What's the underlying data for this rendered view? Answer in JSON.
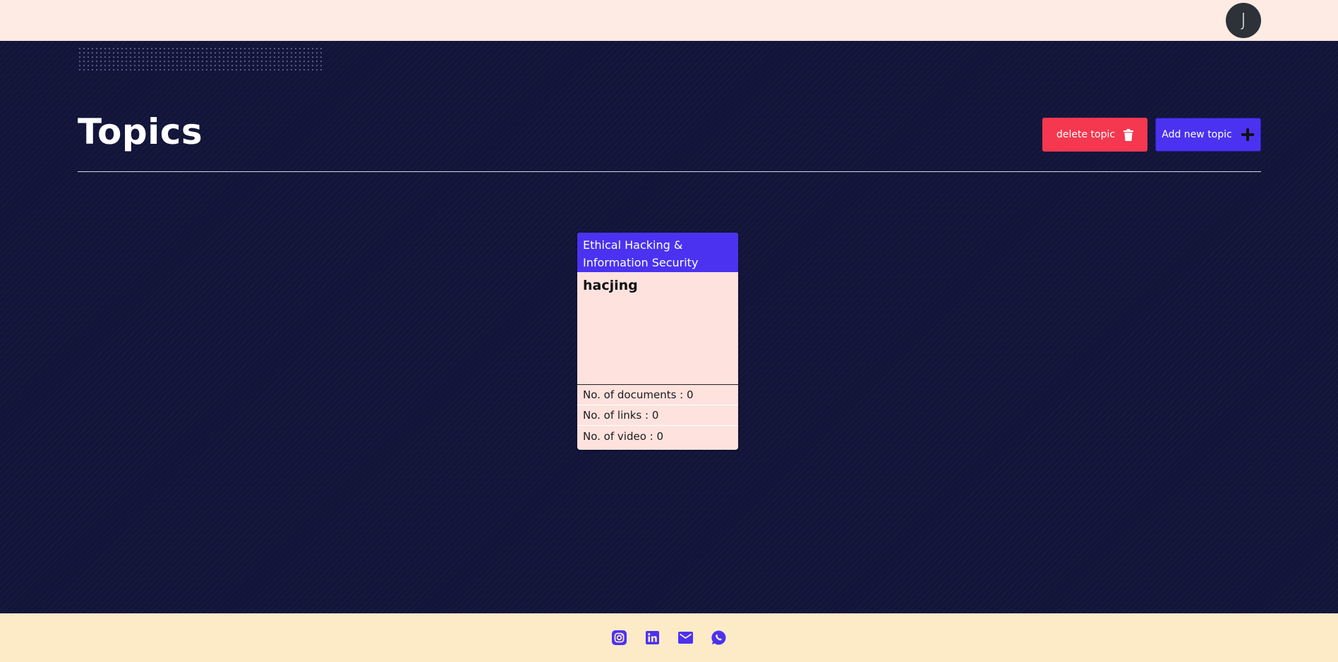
{
  "header": {
    "avatar_initial": "J"
  },
  "main": {
    "title": "Topics",
    "delete_button_label": "delete topic",
    "add_button_label": "Add new topic"
  },
  "topic_card": {
    "category": "Ethical Hacking & Information Security",
    "name": "hacjing",
    "documents_text": "No. of documents : 0",
    "links_text": "No. of links : 0",
    "videos_text": "No. of video : 0"
  },
  "footer": {
    "icons": [
      "instagram-icon",
      "linkedin-icon",
      "mail-icon",
      "whatsapp-icon"
    ]
  },
  "colors": {
    "accent": "#4b32f0",
    "danger": "#f5384f",
    "background": "#121539",
    "topbar": "#fdebe4",
    "footer": "#fdeac7",
    "card": "#fde2de"
  }
}
